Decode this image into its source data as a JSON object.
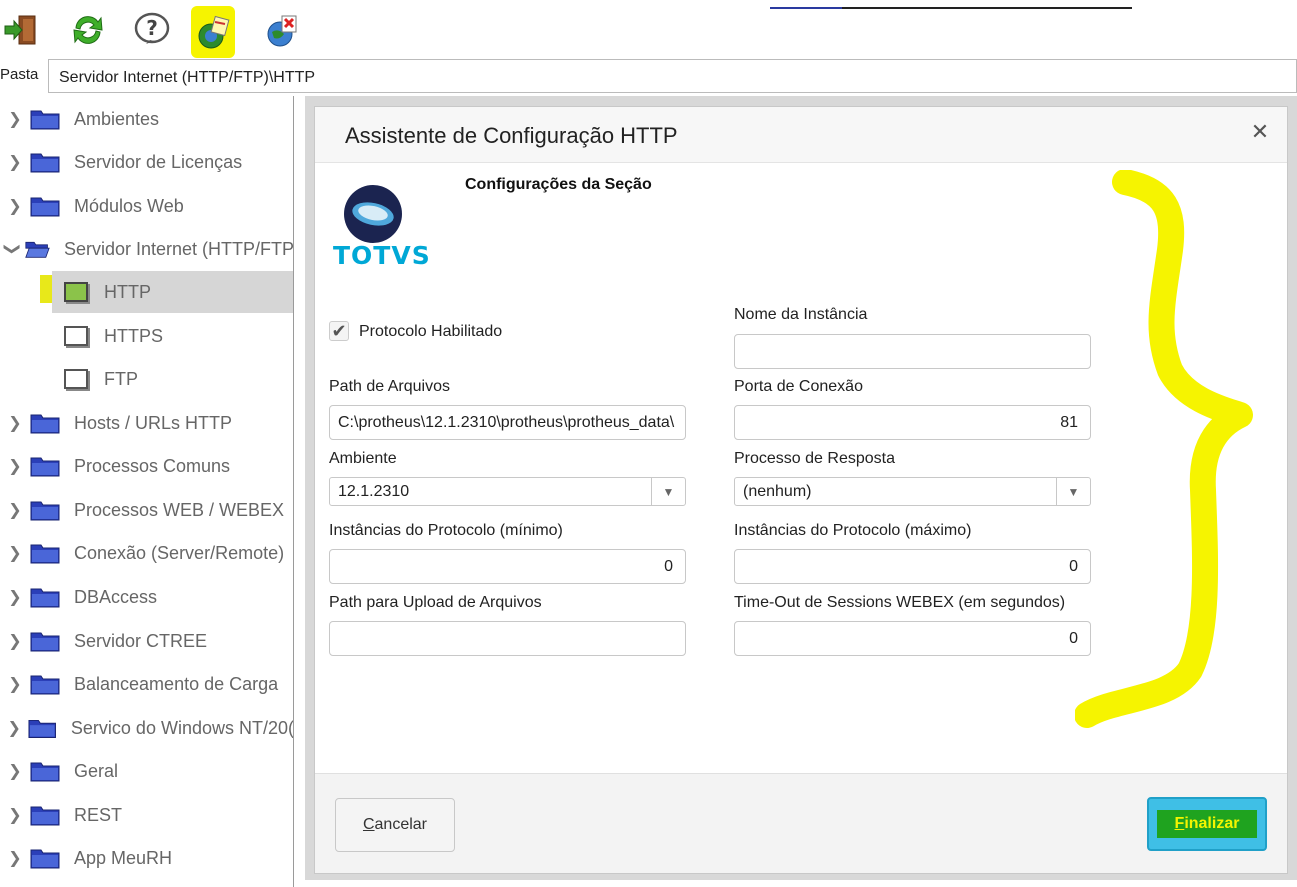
{
  "toolbar": {
    "buttons": [
      {
        "name": "exit",
        "icon": "exit-door-icon"
      },
      {
        "name": "refresh",
        "icon": "refresh-arrows-icon"
      },
      {
        "name": "help",
        "icon": "help-question-icon"
      },
      {
        "name": "edit-config",
        "icon": "edit-globe-icon",
        "highlighted": true
      },
      {
        "name": "delete-config",
        "icon": "delete-globe-icon"
      }
    ],
    "highlight_color": "#f6f400"
  },
  "path": {
    "label": "Pasta",
    "value": "Servidor Internet (HTTP/FTP)\\HTTP"
  },
  "tree": {
    "items": [
      {
        "label": "Ambientes",
        "expanded": false
      },
      {
        "label": "Servidor de Licenças",
        "expanded": false
      },
      {
        "label": "Módulos Web",
        "expanded": false
      },
      {
        "label": "Servidor Internet (HTTP/FTP",
        "expanded": true
      },
      {
        "label": "Hosts / URLs HTTP",
        "expanded": false
      },
      {
        "label": "Processos Comuns",
        "expanded": false
      },
      {
        "label": "Processos WEB / WEBEX",
        "expanded": false
      },
      {
        "label": "Conexão (Server/Remote)",
        "expanded": false
      },
      {
        "label": "DBAccess",
        "expanded": false
      },
      {
        "label": "Servidor CTREE",
        "expanded": false
      },
      {
        "label": "Balanceamento de Carga",
        "expanded": false
      },
      {
        "label": "Servico do Windows NT/20(",
        "expanded": false
      },
      {
        "label": "Geral",
        "expanded": false
      },
      {
        "label": "REST",
        "expanded": false
      },
      {
        "label": "App MeuRH",
        "expanded": false
      }
    ],
    "children": [
      {
        "label": "HTTP",
        "selected": true
      },
      {
        "label": "HTTPS",
        "selected": false
      },
      {
        "label": "FTP",
        "selected": false
      }
    ]
  },
  "dialog": {
    "title": "Assistente de Configuração  HTTP",
    "close_symbol": "✕",
    "section_title": "Configurações da Seção",
    "logo_text": "TOTVS",
    "fields": {
      "protocolo_habilitado": {
        "label": "Protocolo Habilitado",
        "checked": true
      },
      "nome_instancia": {
        "label": "Nome da Instância",
        "value": ""
      },
      "path_arquivos": {
        "label": "Path de Arquivos",
        "value": "C:\\protheus\\12.1.2310\\protheus\\protheus_data\\"
      },
      "porta_conexao": {
        "label": "Porta de Conexão",
        "value": "81"
      },
      "ambiente": {
        "label": "Ambiente",
        "value": "12.1.2310"
      },
      "processo_resposta": {
        "label": "Processo de Resposta",
        "value": "(nenhum)"
      },
      "inst_min": {
        "label": "Instâncias do Protocolo (mínimo)",
        "value": "0"
      },
      "inst_max": {
        "label": "Instâncias do Protocolo (máximo)",
        "value": "0"
      },
      "path_upload": {
        "label": "Path para Upload de Arquivos",
        "value": ""
      },
      "timeout_webex": {
        "label": "Time-Out de Sessions WEBEX (em segundos)",
        "value": "0"
      }
    },
    "buttons": {
      "cancel_first": "C",
      "cancel_rest": "ancelar",
      "finish_first": "F",
      "finish_rest": "inalizar"
    }
  },
  "annotation": {
    "color": "#f6f400",
    "shape": "curly-brace"
  }
}
